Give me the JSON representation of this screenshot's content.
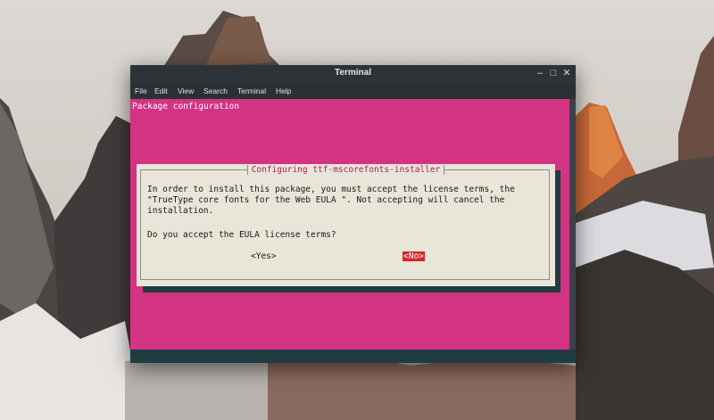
{
  "window": {
    "title": "Terminal",
    "minimize_glyph": "–",
    "maximize_glyph": "□",
    "close_glyph": "✕"
  },
  "menu": [
    "File",
    "Edit",
    "View",
    "Search",
    "Terminal",
    "Help"
  ],
  "terminal": {
    "header": "Package configuration",
    "background_color": "#d23383"
  },
  "dialog": {
    "title": "Configuring ttf-mscorefonts-installer",
    "message": "In order to install this package, you must accept the license terms, the \"TrueType core fonts for the Web EULA \". Not accepting will cancel the installation.",
    "question": "Do you accept the EULA license terms?",
    "yes_label": "<Yes>",
    "no_label": "<No>",
    "selected": "no",
    "selected_color": "#d8262a"
  }
}
